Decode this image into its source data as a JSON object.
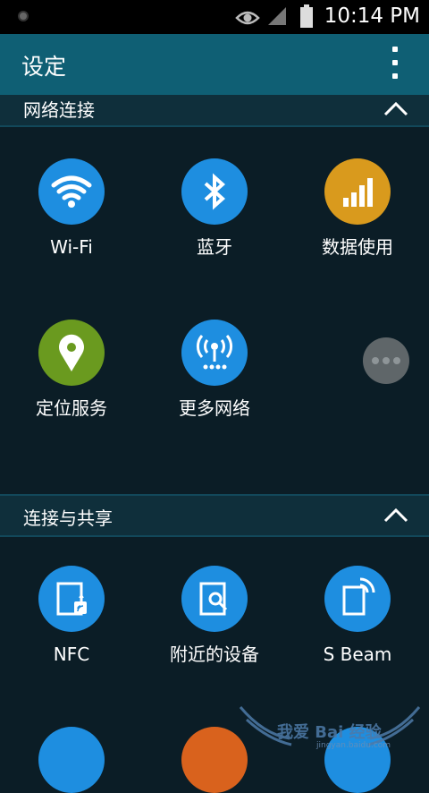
{
  "status_bar": {
    "time": "10:14 PM"
  },
  "app_bar": {
    "title": "设定"
  },
  "sections": [
    {
      "title": "网络连接",
      "items": [
        {
          "label": "Wi-Fi",
          "icon": "wifi-icon",
          "color": "#1e8ee0"
        },
        {
          "label": "蓝牙",
          "icon": "bluetooth-icon",
          "color": "#1e8ee0"
        },
        {
          "label": "数据使用",
          "icon": "data-usage-icon",
          "color": "#d99a1d"
        },
        {
          "label": "定位服务",
          "icon": "location-icon",
          "color": "#6a9a1f"
        },
        {
          "label": "更多网络",
          "icon": "more-networks-icon",
          "color": "#1e8ee0"
        }
      ]
    },
    {
      "title": "连接与共享",
      "items": [
        {
          "label": "NFC",
          "icon": "nfc-icon",
          "color": "#1e8ee0"
        },
        {
          "label": "附近的设备",
          "icon": "nearby-devices-icon",
          "color": "#1e8ee0"
        },
        {
          "label": "S Beam",
          "icon": "s-beam-icon",
          "color": "#1e8ee0"
        }
      ]
    }
  ],
  "watermark": {
    "text": "我爱 Bai 经验",
    "sub": "jingyan.baidu.com"
  }
}
